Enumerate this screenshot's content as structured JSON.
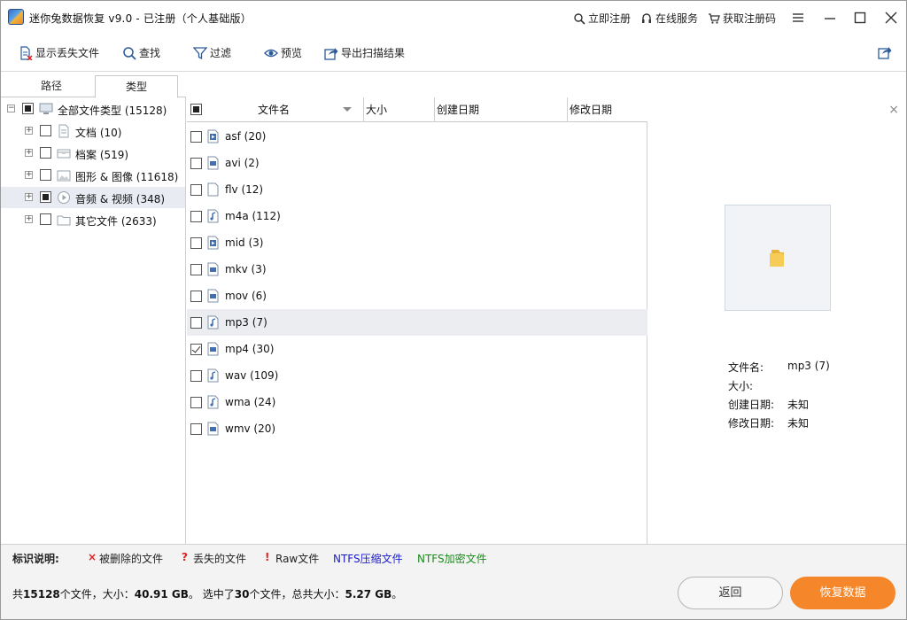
{
  "window": {
    "title": "迷你兔数据恢复 v9.0 - 已注册（个人基础版）",
    "register_now": "立即注册",
    "online_service": "在线服务",
    "get_code": "获取注册码"
  },
  "toolbar": {
    "show_lost": "显示丢失文件",
    "find": "查找",
    "filter": "过滤",
    "preview": "预览",
    "export": "导出扫描结果"
  },
  "tabs": {
    "path": "路径",
    "type": "类型"
  },
  "tree": {
    "root": "全部文件类型 (15128)",
    "items": [
      {
        "label": "文档 (10)",
        "icon": "document-icon"
      },
      {
        "label": "档案 (519)",
        "icon": "archive-icon"
      },
      {
        "label": "图形 & 图像 (11618)",
        "icon": "image-icon"
      },
      {
        "label": "音频 & 视频 (348)",
        "icon": "media-icon"
      },
      {
        "label": "其它文件 (2633)",
        "icon": "folder-icon"
      }
    ]
  },
  "list": {
    "columns": {
      "name": "文件名",
      "size": "大小",
      "created": "创建日期",
      "modified": "修改日期"
    },
    "rows": [
      {
        "name": "asf (20)",
        "checked": false,
        "icon": "media-file-icon"
      },
      {
        "name": "avi (2)",
        "checked": false,
        "icon": "video-file-icon"
      },
      {
        "name": "flv (12)",
        "checked": false,
        "icon": "blank-file-icon"
      },
      {
        "name": "m4a (112)",
        "checked": false,
        "icon": "audio-file-icon"
      },
      {
        "name": "mid (3)",
        "checked": false,
        "icon": "media-file-icon"
      },
      {
        "name": "mkv (3)",
        "checked": false,
        "icon": "video-file-icon"
      },
      {
        "name": "mov (6)",
        "checked": false,
        "icon": "video-file-icon"
      },
      {
        "name": "mp3 (7)",
        "checked": false,
        "icon": "audio-file-icon",
        "selected": true
      },
      {
        "name": "mp4 (30)",
        "checked": true,
        "icon": "video-file-icon"
      },
      {
        "name": "wav (109)",
        "checked": false,
        "icon": "audio-file-icon"
      },
      {
        "name": "wma (24)",
        "checked": false,
        "icon": "audio-file-icon"
      },
      {
        "name": "wmv (20)",
        "checked": false,
        "icon": "video-file-icon"
      }
    ]
  },
  "preview": {
    "close": "×",
    "labels": {
      "name": "文件名:",
      "size": "大小:",
      "created": "创建日期:",
      "modified": "修改日期:"
    },
    "values": {
      "name": "mp3 (7)",
      "size": "",
      "created": "未知",
      "modified": "未知"
    }
  },
  "legend": {
    "title": "标识说明:",
    "deleted_mark": "×",
    "deleted": "被删除的文件",
    "lost_mark": "?",
    "lost": "丢失的文件",
    "raw_mark": "!",
    "raw": "Raw文件",
    "ntfs_compressed": "NTFS压缩文件",
    "ntfs_encrypted": "NTFS加密文件",
    "colors": {
      "mark": "#e02020",
      "compressed": "#1a1ad0",
      "encrypted": "#1a8a1a"
    }
  },
  "status": {
    "p1": "共",
    "total_count": "15128",
    "p2": "个文件，大小：",
    "total_size": "40.91 GB",
    "p3": "。 选中了",
    "sel_count": "30",
    "p4": "个文件，总共大小：",
    "sel_size": "5.27 GB",
    "p5": "。"
  },
  "buttons": {
    "back": "返回",
    "recover": "恢复数据"
  },
  "colors": {
    "accent": "#f5862a"
  }
}
